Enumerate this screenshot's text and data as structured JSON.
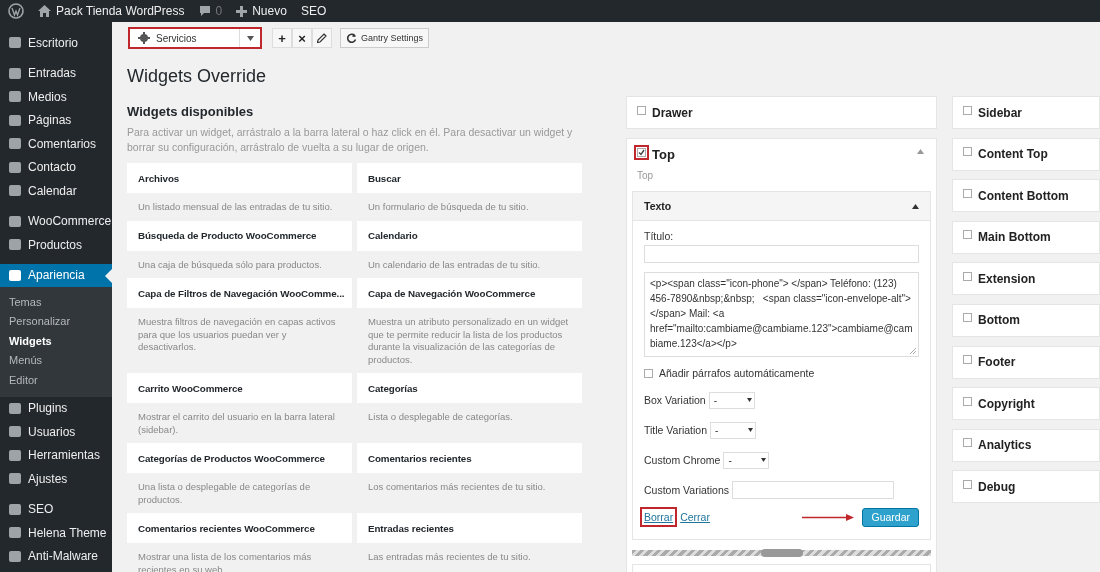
{
  "admin_bar": {
    "site_name": "Pack Tienda WordPress",
    "comment_count": "0",
    "new_label": "Nuevo",
    "seo_label": "SEO"
  },
  "sidebar": {
    "groups": [
      {
        "items": [
          {
            "label": "Escritorio",
            "selected": false
          }
        ]
      },
      {
        "items": [
          {
            "label": "Entradas",
            "selected": false
          },
          {
            "label": "Medios",
            "selected": false
          },
          {
            "label": "Páginas",
            "selected": false
          },
          {
            "label": "Comentarios",
            "selected": false
          },
          {
            "label": "Contacto",
            "selected": false
          },
          {
            "label": "Calendar",
            "selected": false
          }
        ]
      },
      {
        "items": [
          {
            "label": "WooCommerce",
            "selected": false
          },
          {
            "label": "Productos",
            "selected": false
          }
        ]
      },
      {
        "items": [
          {
            "label": "Apariencia",
            "selected": true,
            "children": [
              {
                "label": "Temas",
                "selected": false
              },
              {
                "label": "Personalizar",
                "selected": false
              },
              {
                "label": "Widgets",
                "selected": true
              },
              {
                "label": "Menús",
                "selected": false
              },
              {
                "label": "Editor",
                "selected": false
              }
            ]
          },
          {
            "label": "Plugins",
            "selected": false
          },
          {
            "label": "Usuarios",
            "selected": false
          },
          {
            "label": "Herramientas",
            "selected": false
          },
          {
            "label": "Ajustes",
            "selected": false
          }
        ]
      },
      {
        "items": [
          {
            "label": "SEO",
            "selected": false
          },
          {
            "label": "Helena Theme",
            "selected": false
          },
          {
            "label": "Anti-Malware",
            "selected": false
          }
        ]
      }
    ]
  },
  "toolbar": {
    "selector": {
      "value": "Servicios",
      "highlighted": true
    },
    "icon_buttons": [
      "+",
      "×"
    ],
    "settings_button": "Gantry Settings"
  },
  "page_title": "Widgets Override",
  "available": {
    "title": "Widgets disponibles",
    "description": "Para activar un widget, arrástralo a la barra lateral o haz click en él. Para desactivar un widget y borrar su configuración, arrástralo de vuelta a su lugar de origen.",
    "widgets": [
      {
        "name": "Archivos",
        "description": "Un listado mensual de las entradas de tu sitio."
      },
      {
        "name": "Buscar",
        "description": "Un formulario de búsqueda de tu sitio."
      },
      {
        "name": "Búsqueda de Producto WooCommerce",
        "description": "Una caja de búsqueda sólo para productos."
      },
      {
        "name": "Calendario",
        "description": "Un calendario de las entradas de tu sitio."
      },
      {
        "name": "Capa de Filtros de Navegación WooComme...",
        "description": "Muestra filtros de navegación en capas activos para que los usuarios puedan ver y desactivarlos."
      },
      {
        "name": "Capa de Navegación WooCommerce",
        "description": "Muestra un atributo personalizado en un widget que te permite reducir la lista de los productos durante la visualización de las categorías de productos."
      },
      {
        "name": "Carrito WooCommerce",
        "description": "Mostrar el carrito del usuario en la barra lateral (sidebar)."
      },
      {
        "name": "Categorías",
        "description": "Lista o desplegable de categorías."
      },
      {
        "name": "Categorías de Productos WooCommerce",
        "description": "Una lista o desplegable de categorías de productos."
      },
      {
        "name": "Comentarios recientes",
        "description": "Los comentarios más recientes de tu sitio."
      },
      {
        "name": "Comentarios recientes WooCommerce",
        "description": "Mostrar una lista de los comentarios más recientes en su web."
      },
      {
        "name": "Entradas recientes",
        "description": "Las entradas más recientes de tu sitio."
      }
    ]
  },
  "area_columns": [
    {
      "areas": [
        {
          "label": "Drawer",
          "checked": false,
          "expanded": false,
          "highlighted": false
        },
        {
          "label": "Top",
          "checked": true,
          "expanded": true,
          "highlighted": true,
          "subtitle": "Top",
          "widget": {
            "title": "Texto",
            "expanded": true,
            "title_label": "Título:",
            "text": "<p><span class=\"icon-phone\"> </span> Teléfono: (123) 456-7890&nbsp;&nbsp;   <span class=\"icon-envelope-alt\"> </span> Mail: <a href=\"mailto:cambiame@cambiame.123\">cambiame@cambiame.123</a></p>",
            "autop": {
              "label": "Añadir párrafos automáticamente",
              "checked": false
            },
            "fields": [
              {
                "kind": "select",
                "label": "Box Variation",
                "value": "-"
              },
              {
                "kind": "select",
                "label": "Title Variation",
                "value": "-"
              },
              {
                "kind": "select",
                "label": "Custom Chrome",
                "value": "-"
              },
              {
                "kind": "input",
                "label": "Custom Variations"
              }
            ],
            "delete_link": {
              "label": "Borrar",
              "highlighted": true
            },
            "close_link": "Cerrar",
            "save_button": {
              "label": "Guardar",
              "pointed": true
            }
          }
        }
      ]
    },
    {
      "areas": [
        {
          "label": "Sidebar",
          "checked": false,
          "expanded": false,
          "highlighted": false
        },
        {
          "label": "Content Top",
          "checked": false,
          "expanded": false,
          "highlighted": false
        },
        {
          "label": "Content Bottom",
          "checked": false,
          "expanded": false,
          "highlighted": false
        },
        {
          "label": "Main Bottom",
          "checked": false,
          "expanded": false,
          "highlighted": false
        },
        {
          "label": "Extension",
          "checked": false,
          "expanded": false,
          "highlighted": false
        },
        {
          "label": "Bottom",
          "checked": false,
          "expanded": false,
          "highlighted": false
        },
        {
          "label": "Footer",
          "checked": false,
          "expanded": false,
          "highlighted": false
        },
        {
          "label": "Copyright",
          "checked": false,
          "expanded": false,
          "highlighted": false
        },
        {
          "label": "Analytics",
          "checked": false,
          "expanded": false,
          "highlighted": false
        },
        {
          "label": "Debug",
          "checked": false,
          "expanded": false,
          "highlighted": false
        }
      ]
    }
  ]
}
